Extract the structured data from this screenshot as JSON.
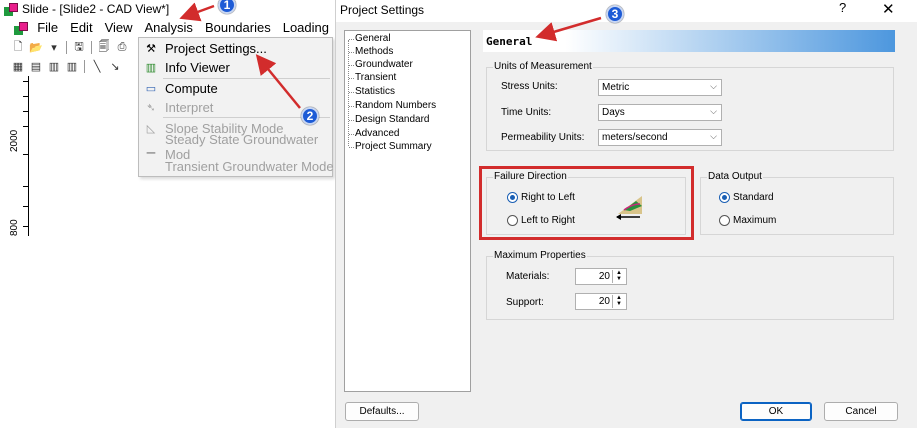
{
  "app": {
    "title": "Slide - [Slide2 - CAD View*]",
    "menus": [
      "File",
      "Edit",
      "View",
      "Analysis",
      "Boundaries",
      "Loading"
    ],
    "ruler_labels": [
      "2000",
      "800"
    ]
  },
  "analysis_menu": {
    "items": [
      {
        "label": "Project Settings...",
        "icon": "project-settings-icon",
        "enabled": true
      },
      {
        "label": "Info Viewer",
        "icon": "info-viewer-icon",
        "enabled": true
      },
      {
        "label": "Compute",
        "icon": "compute-icon",
        "enabled": true
      },
      {
        "label": "Interpret",
        "icon": "interpret-icon",
        "enabled": false
      },
      {
        "label": "Slope Stability Mode",
        "icon": "slope-mode-icon",
        "enabled": false
      },
      {
        "label": "Steady State Groundwater Mod",
        "icon": "steady-state-icon",
        "enabled": false
      },
      {
        "label": "Transient Groundwater Mode",
        "icon": "transient-icon",
        "enabled": false
      }
    ]
  },
  "dialog": {
    "title": "Project Settings",
    "help": "?",
    "close": "✕",
    "nav": [
      "General",
      "Methods",
      "Groundwater",
      "Transient",
      "Statistics",
      "Random Numbers",
      "Design Standard",
      "Advanced",
      "Project Summary"
    ],
    "header": "General",
    "units": {
      "group_label": "Units of Measurement",
      "stress_label": "Stress Units:",
      "stress_value": "Metric",
      "time_label": "Time Units:",
      "time_value": "Days",
      "perm_label": "Permeability Units:",
      "perm_value": "meters/second"
    },
    "failure": {
      "group_label": "Failure Direction",
      "option1": "Right to Left",
      "option2": "Left to Right",
      "selected": "Right to Left"
    },
    "output": {
      "group_label": "Data Output",
      "option1": "Standard",
      "option2": "Maximum",
      "selected": "Standard"
    },
    "maxprops": {
      "group_label": "Maximum Properties",
      "materials_label": "Materials:",
      "materials_value": "20",
      "support_label": "Support:",
      "support_value": "20"
    },
    "buttons": {
      "defaults": "Defaults...",
      "ok": "OK",
      "cancel": "Cancel"
    }
  },
  "annotations": {
    "badge1": "1",
    "badge2": "2",
    "badge3": "3",
    "color": "#d22c2c",
    "badge_color": "#1d5bd6"
  }
}
